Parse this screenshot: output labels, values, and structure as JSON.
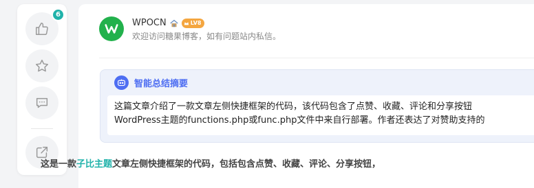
{
  "sidebar": {
    "like": {
      "icon": "thumbs-up-icon",
      "count": "6"
    },
    "favorite": {
      "icon": "star-icon"
    },
    "comment": {
      "icon": "comment-icon"
    },
    "share": {
      "icon": "share-icon"
    }
  },
  "author": {
    "name": "WPOCN",
    "level": "LV8",
    "description": "欢迎访问糖果博客，如有问题站内私信。",
    "avatar_color": "#22b14c"
  },
  "summary": {
    "title": "智能总结摘要",
    "line1": "这篇文章介绍了一款文章左侧快捷框架的代码，该代码包含了点赞、收藏、评论和分享按钮",
    "line2": "WordPress主题的functions.php或func.php文件中来自行部署。作者还表达了对赞助支持的",
    "accent_color": "#4e6ef2"
  },
  "article": {
    "text_before": "这是一款",
    "link_text": "子比主题",
    "text_after": "文章左侧快捷框架的代码，包括包含点赞、收藏、评论、分享按钮，",
    "link_color": "#20b2aa"
  }
}
